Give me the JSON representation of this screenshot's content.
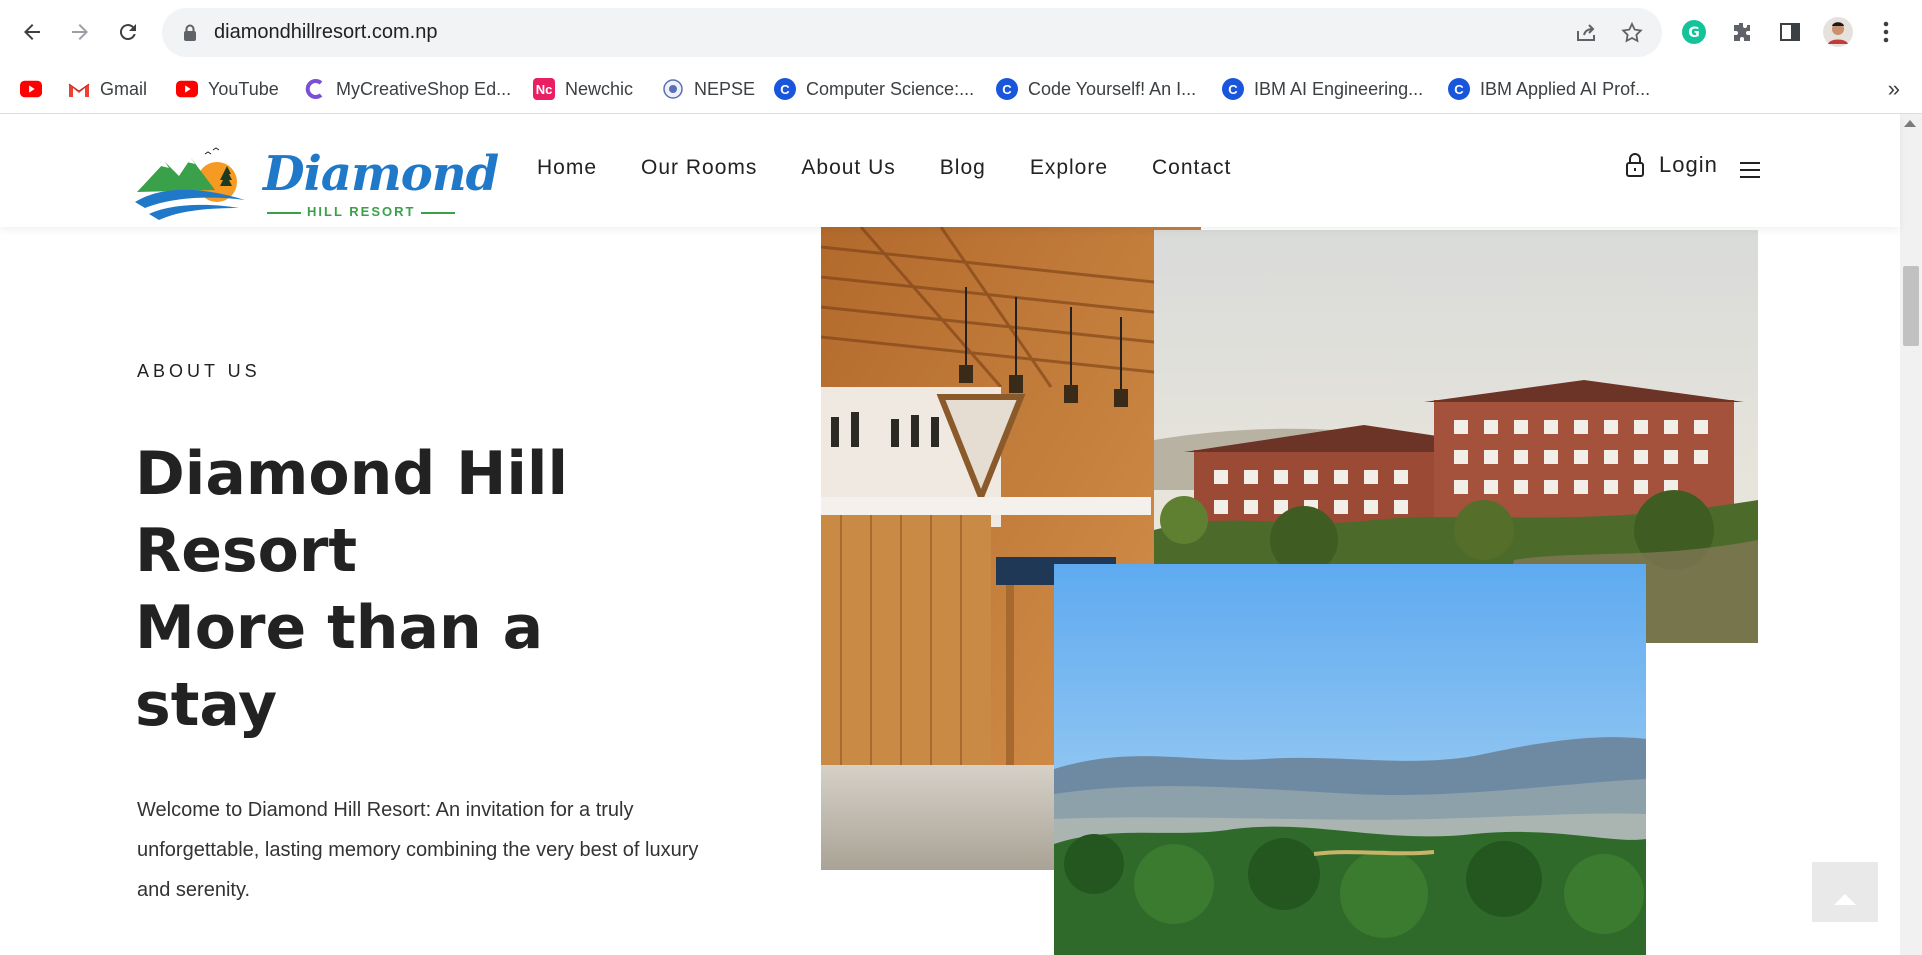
{
  "browser": {
    "url": "diamondhillresort.com.np",
    "bookmarks": [
      {
        "label": "",
        "icon": "youtube-icon"
      },
      {
        "label": "Gmail",
        "icon": "gmail-icon"
      },
      {
        "label": "YouTube",
        "icon": "youtube-icon"
      },
      {
        "label": "MyCreativeShop Ed...",
        "icon": "mycreativeshop-icon"
      },
      {
        "label": "Newchic",
        "icon": "newchic-icon"
      },
      {
        "label": "NEPSE",
        "icon": "nepse-icon"
      },
      {
        "label": "Computer Science:...",
        "icon": "coursera-icon"
      },
      {
        "label": "Code Yourself! An I...",
        "icon": "coursera-icon"
      },
      {
        "label": "IBM AI Engineering...",
        "icon": "coursera-icon"
      },
      {
        "label": "IBM Applied AI Prof...",
        "icon": "coursera-icon"
      }
    ],
    "more": "»"
  },
  "site": {
    "logo_word": "Diamond",
    "logo_sub": "HILL RESORT",
    "menu": [
      "Home",
      "Our Rooms",
      "About Us",
      "Blog",
      "Explore",
      "Contact"
    ],
    "login": "Login"
  },
  "about": {
    "label": "ABOUT US",
    "headline": [
      "Diamond Hill",
      "Resort",
      "More than a",
      "stay"
    ],
    "intro": "Welcome to Diamond Hill Resort: An invitation for a truly unforgettable, lasting memory combining the very best of luxury and serenity."
  },
  "colors": {
    "logo_blue": "#1f78c8",
    "logo_green": "#3aa14a",
    "text": "#222222"
  }
}
